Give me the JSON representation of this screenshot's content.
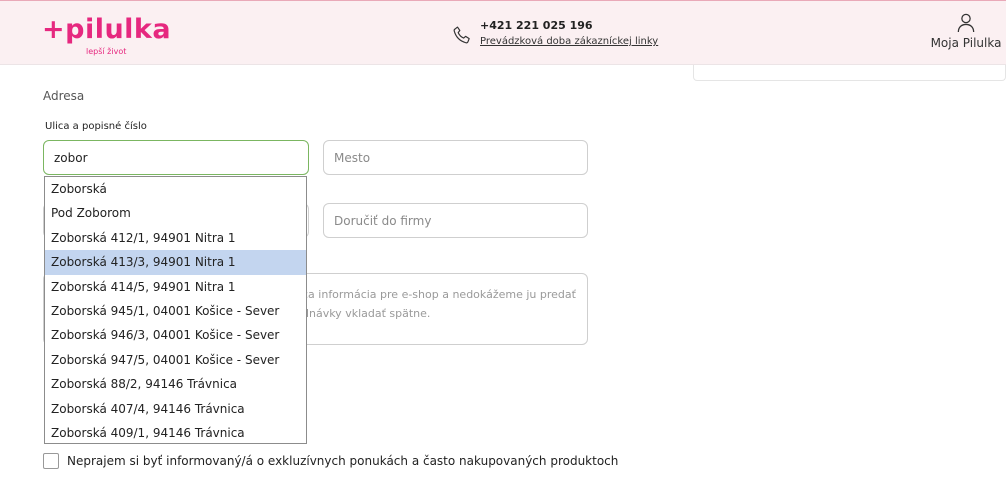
{
  "header": {
    "logo_text": "+pilulka",
    "logo_tagline": "lepší život",
    "phone_number": "+421 221 025 196",
    "phone_hours_link": "Prevádzková doba zákazníckej linky",
    "account_label": "Moja Pilulka"
  },
  "colors": {
    "brand": "#e6287f",
    "header_bg": "#fbf0f2",
    "focus_border": "#7bb661",
    "selected_option_bg": "#c3d5ef"
  },
  "address_form": {
    "section_title": "Adresa",
    "street_label": "Ulica a popisné číslo",
    "street_value": "zobor",
    "city_placeholder": "Mesto",
    "company_placeholder": "Doručiť do firmy",
    "note_text": "ca informácia pre e-shop a nedokážeme ju predať dnávky vkladať spätne."
  },
  "autocomplete": {
    "selected_index": 3,
    "options": [
      "Zoborská",
      "Pod Zoborom",
      "Zoborská 412/1, 94901 Nitra 1",
      "Zoborská 413/3, 94901 Nitra 1",
      "Zoborská 414/5, 94901 Nitra 1",
      "Zoborská 945/1, 04001 Košice - Sever",
      "Zoborská 946/3, 04001 Košice - Sever",
      "Zoborská 947/5, 04001 Košice - Sever",
      "Zoborská 88/2, 94146 Trávnica",
      "Zoborská 407/4, 94146 Trávnica",
      "Zoborská 409/1, 94146 Trávnica"
    ]
  },
  "newsletter": {
    "checkbox_label": "Neprajem si byť informovaný/á o exkluzívnych ponukách a často nakupovaných produktoch",
    "checked": false
  }
}
